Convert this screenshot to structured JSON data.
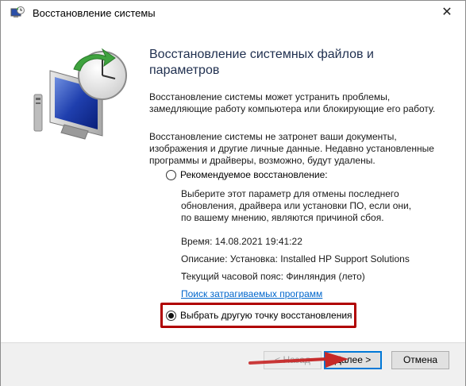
{
  "window": {
    "title": "Восстановление системы",
    "close_glyph": "✕"
  },
  "main": {
    "heading": "Восстановление системных файлов и параметров",
    "intro_1": "Восстановление системы может устранить проблемы, замедляющие работу компьютера или блокирующие его работу.",
    "intro_2": "Восстановление системы не затронет ваши документы, изображения и другие личные данные. Недавно установленные программы и драйверы, возможно, будут удалены."
  },
  "options": {
    "recommended_label": "Рекомендуемое восстановление:",
    "recommended_selected": false,
    "recommended_description": "Выберите этот параметр для отмены последнего обновления, драйвера или установки ПО, если они, по вашему мнению, являются причиной сбоя.",
    "time": "Время: 14.08.2021 19:41:22",
    "description": "Описание: Установка: Installed HP Support Solutions ...",
    "timezone": "Текущий часовой пояс: Финляндия (лето)",
    "affected_programs_link": "Поиск затрагиваемых программ",
    "choose_other_label": "Выбрать другую точку восстановления",
    "choose_other_selected": true
  },
  "buttons": {
    "back": "< Назад",
    "next": "Далее >",
    "cancel": "Отмена"
  },
  "colors": {
    "accent": "#0078d7",
    "highlight": "#b00000",
    "arrow": "#c62828",
    "link": "#0066cc"
  },
  "icons": {
    "title": "system-restore-icon",
    "hero": "monitor-clock-restore-icon"
  }
}
